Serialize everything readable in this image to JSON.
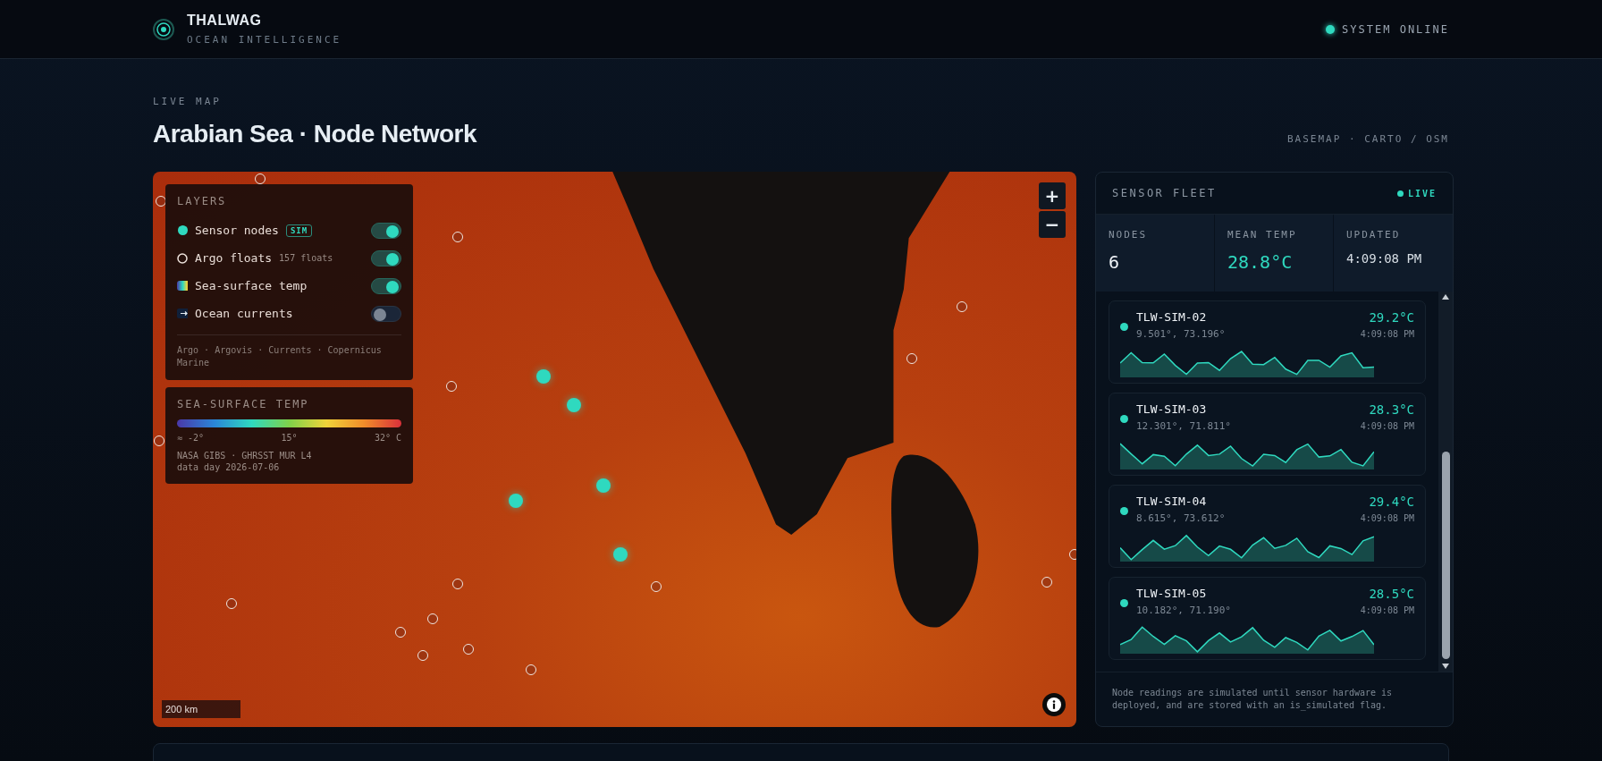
{
  "header": {
    "brand": "THALWAG",
    "tagline": "OCEAN INTELLIGENCE",
    "status": {
      "label": "SYSTEM ONLINE",
      "online": true
    }
  },
  "page": {
    "eyebrow": "LIVE MAP",
    "title": "Arabian Sea · Node Network",
    "basemap": "BASEMAP · CARTO / OSM"
  },
  "map": {
    "layers_panel": {
      "title": "LAYERS",
      "layers": [
        {
          "kind": "sensor",
          "label": "Sensor nodes",
          "badge": "SIM",
          "on": true
        },
        {
          "kind": "argo",
          "label": "Argo floats",
          "note": "157 floats",
          "on": true
        },
        {
          "kind": "sst",
          "label": "Sea-surface temp",
          "on": true
        },
        {
          "kind": "currents",
          "label": "Ocean currents",
          "on": false
        }
      ],
      "attribution": "Argo · Argovis · Currents · Copernicus Marine"
    },
    "legend": {
      "title": "SEA-SURFACE TEMP",
      "ticks": [
        "≈ -2°",
        "15°",
        "32° C"
      ],
      "source": "NASA GIBS · GHRSST MUR L4",
      "date": "data day 2026-07-06"
    },
    "zoom_in": "+",
    "zoom_out": "−",
    "scale": "200 km"
  },
  "fleet": {
    "title": "SENSOR FLEET",
    "live": "LIVE",
    "stats": [
      {
        "kind": "count",
        "label": "NODES",
        "value": "6"
      },
      {
        "kind": "temp",
        "label": "MEAN TEMP",
        "value": "28.8°C"
      },
      {
        "kind": "time",
        "label": "UPDATED",
        "value": "4:09:08 PM"
      }
    ],
    "nodes": [
      {
        "id": "TLW-SIM-02",
        "coords": "9.501°, 73.196°",
        "temp": "29.2°C",
        "time": "4:09:08 PM"
      },
      {
        "id": "TLW-SIM-03",
        "coords": "12.301°, 71.811°",
        "temp": "28.3°C",
        "time": "4:09:08 PM"
      },
      {
        "id": "TLW-SIM-04",
        "coords": "8.615°, 73.612°",
        "temp": "29.4°C",
        "time": "4:09:08 PM"
      },
      {
        "id": "TLW-SIM-05",
        "coords": "10.182°, 71.190°",
        "temp": "28.5°C",
        "time": "4:09:08 PM"
      }
    ],
    "note": "Node readings are simulated until sensor hardware is deployed, and are stored with an is_simulated flag."
  }
}
